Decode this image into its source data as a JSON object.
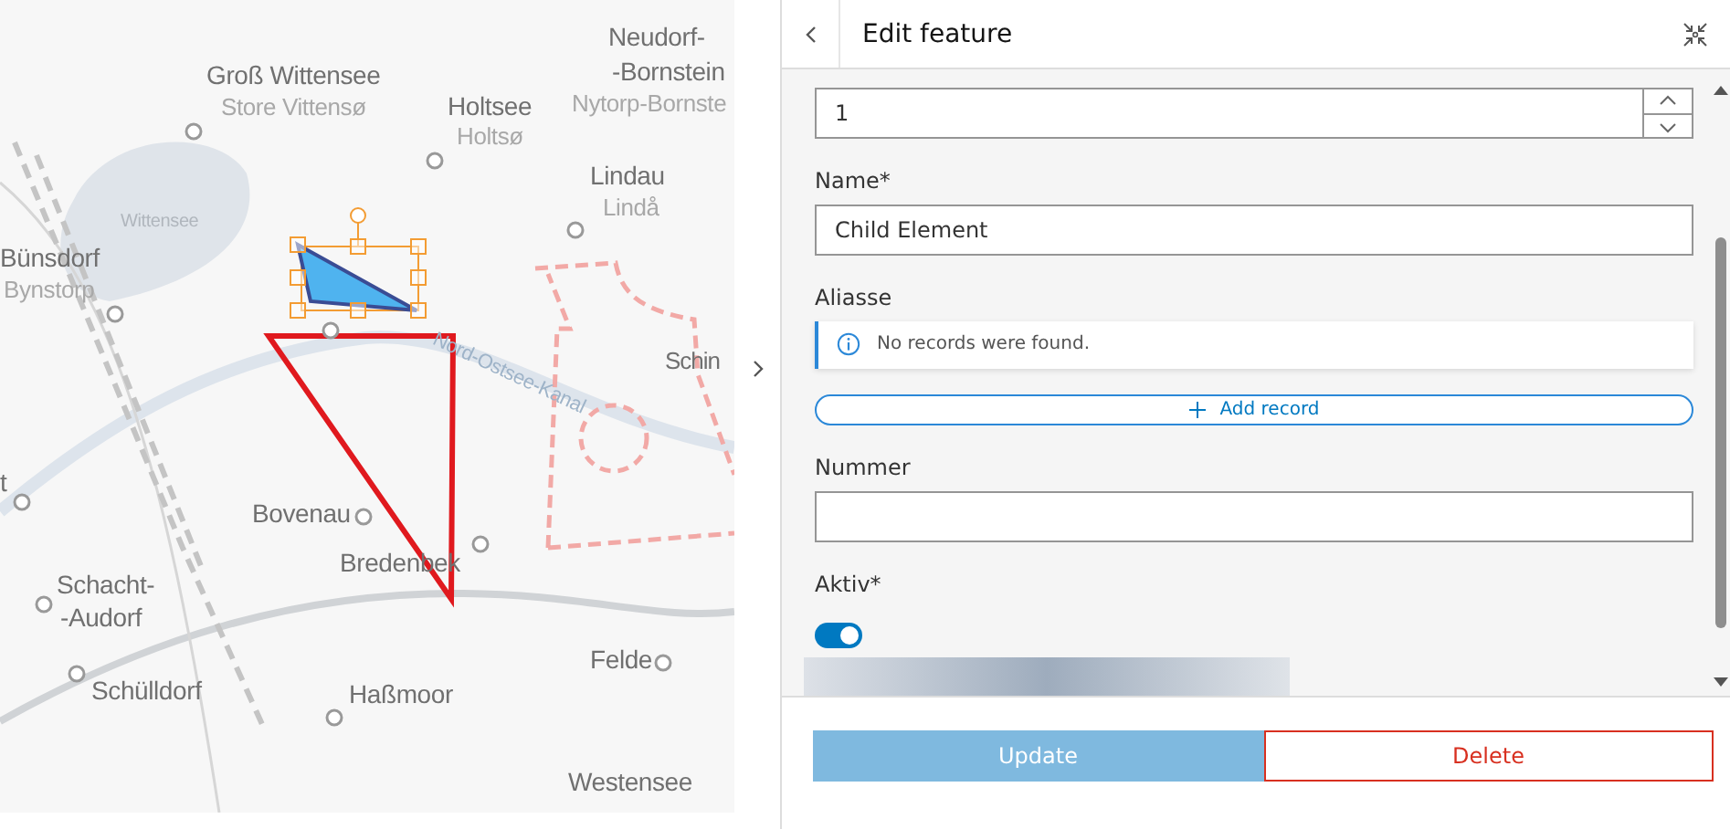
{
  "map": {
    "places": [
      {
        "text": "Neudorf-",
        "kind": "town"
      },
      {
        "text": "-Bornstein",
        "kind": "town"
      },
      {
        "text": "Nytorp-Bornste",
        "kind": "alt"
      },
      {
        "text": "Groß Wittensee",
        "kind": "town"
      },
      {
        "text": "Store Vittensø",
        "kind": "alt"
      },
      {
        "text": "Holtsee",
        "kind": "town"
      },
      {
        "text": "Holtsø",
        "kind": "alt"
      },
      {
        "text": "Lindau",
        "kind": "town"
      },
      {
        "text": "Lindå",
        "kind": "alt"
      },
      {
        "text": "Wittensee",
        "kind": "water"
      },
      {
        "text": "Bünsdorf",
        "kind": "town"
      },
      {
        "text": "Bynstorp",
        "kind": "alt"
      },
      {
        "text": "Schin",
        "kind": "town"
      },
      {
        "text": "Nord-Ostsee-Kanal",
        "kind": "canal"
      },
      {
        "text": "t",
        "kind": "town"
      },
      {
        "text": "Bovenau",
        "kind": "town"
      },
      {
        "text": "Bredenbek",
        "kind": "town"
      },
      {
        "text": "Schacht-",
        "kind": "town"
      },
      {
        "text": "-Audorf",
        "kind": "town"
      },
      {
        "text": "Felde",
        "kind": "town"
      },
      {
        "text": "Schülldorf",
        "kind": "town"
      },
      {
        "text": "Haßmoor",
        "kind": "town"
      },
      {
        "text": "Westensee",
        "kind": "town"
      }
    ]
  },
  "panel": {
    "title": "Edit feature",
    "fields": [
      {
        "kind": "number",
        "value": "1"
      },
      {
        "kind": "text",
        "label": "Name*",
        "value": "Child Element"
      },
      {
        "kind": "records",
        "label": "Aliasse",
        "notice": "No records were found.",
        "action": "Add record"
      },
      {
        "kind": "text",
        "label": "Nummer"
      },
      {
        "kind": "toggle",
        "label": "Aktiv*",
        "on": true
      },
      {
        "kind": "blurred"
      }
    ],
    "buttons": [
      {
        "label": "Update",
        "kind": "primary",
        "disabled": true
      },
      {
        "label": "Delete",
        "kind": "danger",
        "disabled": false
      }
    ]
  }
}
